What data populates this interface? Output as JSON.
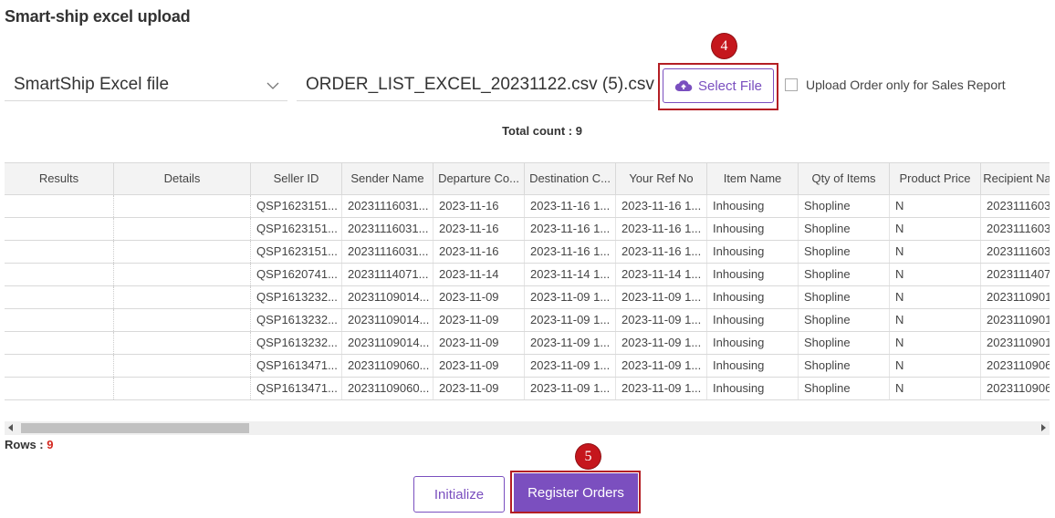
{
  "page_title": "Smart-ship excel upload",
  "file_type_select": {
    "value": "SmartShip Excel file"
  },
  "file_name_field": {
    "value": "ORDER_LIST_EXCEL_20231122.csv (5).csv"
  },
  "select_file_button": {
    "label": "Select File",
    "icon": "cloud-upload-icon"
  },
  "sales_report_checkbox": {
    "label": "Upload Order only for Sales Report",
    "checked": false
  },
  "markers": {
    "step4": "4",
    "step5": "5"
  },
  "total_count": "Total count : 9",
  "table": {
    "columns": [
      "Results",
      "Details",
      "Seller ID",
      "Sender Name",
      "Departure Co...",
      "Destination C...",
      "Your Ref No",
      "Item Name",
      "Qty of Items",
      "Product Price",
      "Recipient Na"
    ],
    "rows": [
      [
        "",
        "",
        "QSP1623151...",
        "20231116031...",
        "2023-11-16",
        "2023-11-16 1...",
        "2023-11-16 1...",
        "Inhousing",
        "Shopline",
        "N",
        "2023111603"
      ],
      [
        "",
        "",
        "QSP1623151...",
        "20231116031...",
        "2023-11-16",
        "2023-11-16 1...",
        "2023-11-16 1...",
        "Inhousing",
        "Shopline",
        "N",
        "2023111603"
      ],
      [
        "",
        "",
        "QSP1623151...",
        "20231116031...",
        "2023-11-16",
        "2023-11-16 1...",
        "2023-11-16 1...",
        "Inhousing",
        "Shopline",
        "N",
        "2023111603"
      ],
      [
        "",
        "",
        "QSP1620741...",
        "20231114071...",
        "2023-11-14",
        "2023-11-14 1...",
        "2023-11-14 1...",
        "Inhousing",
        "Shopline",
        "N",
        "2023111407"
      ],
      [
        "",
        "",
        "QSP1613232...",
        "20231109014...",
        "2023-11-09",
        "2023-11-09 1...",
        "2023-11-09 1...",
        "Inhousing",
        "Shopline",
        "N",
        "2023110901"
      ],
      [
        "",
        "",
        "QSP1613232...",
        "20231109014...",
        "2023-11-09",
        "2023-11-09 1...",
        "2023-11-09 1...",
        "Inhousing",
        "Shopline",
        "N",
        "2023110901"
      ],
      [
        "",
        "",
        "QSP1613232...",
        "20231109014...",
        "2023-11-09",
        "2023-11-09 1...",
        "2023-11-09 1...",
        "Inhousing",
        "Shopline",
        "N",
        "2023110901"
      ],
      [
        "",
        "",
        "QSP1613471...",
        "20231109060...",
        "2023-11-09",
        "2023-11-09 1...",
        "2023-11-09 1...",
        "Inhousing",
        "Shopline",
        "N",
        "2023110906"
      ],
      [
        "",
        "",
        "QSP1613471...",
        "20231109060...",
        "2023-11-09",
        "2023-11-09 1...",
        "2023-11-09 1...",
        "Inhousing",
        "Shopline",
        "N",
        "2023110906"
      ]
    ]
  },
  "rows_label": {
    "prefix": "Rows : ",
    "count": "9"
  },
  "buttons": {
    "initialize": "Initialize",
    "register": "Register Orders"
  },
  "colors": {
    "accent": "#7b4fbf",
    "marker": "#c5171d",
    "highlight_frame": "#b41e24",
    "rows_count": "#d4281f"
  }
}
